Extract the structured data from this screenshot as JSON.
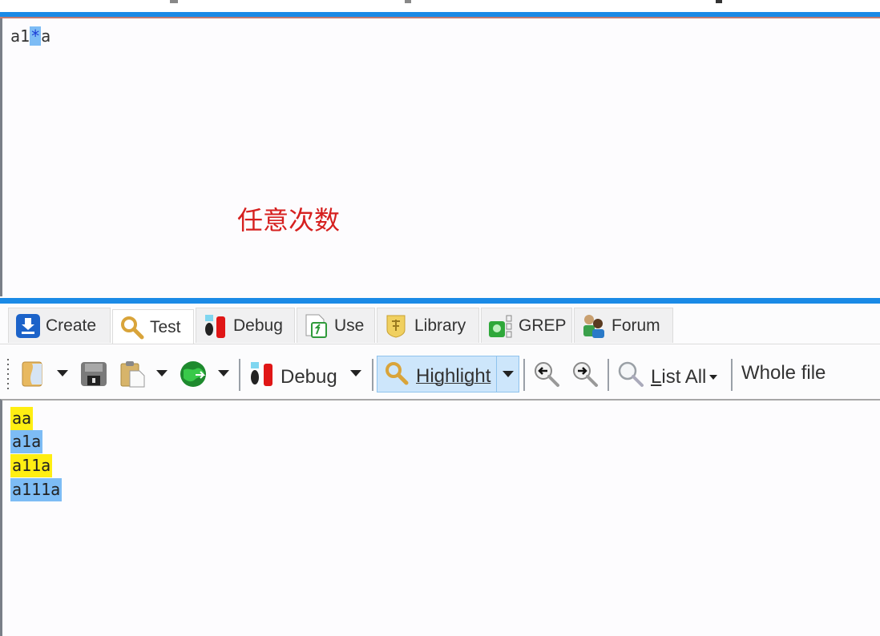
{
  "regex_editor": {
    "before": "a1",
    "highlighted": "*",
    "after": "a"
  },
  "annotation": {
    "text": "任意次数",
    "color": "#d6201f"
  },
  "tabs": [
    {
      "label": "Create",
      "icon": "create-icon",
      "active": false
    },
    {
      "label": "Test",
      "icon": "magnifier-icon",
      "active": true
    },
    {
      "label": "Debug",
      "icon": "debug-icon",
      "active": false
    },
    {
      "label": "Use",
      "icon": "use-icon",
      "active": false
    },
    {
      "label": "Library",
      "icon": "library-icon",
      "active": false
    },
    {
      "label": "GREP",
      "icon": "grep-icon",
      "active": false
    },
    {
      "label": "Forum",
      "icon": "forum-icon",
      "active": false
    }
  ],
  "toolbar": {
    "debug_label": "Debug",
    "highlight_label": "Highlight",
    "list_all_label": "List All",
    "scope_label": "Whole file"
  },
  "results": {
    "lines": [
      {
        "text": "aa",
        "highlight": "yellow"
      },
      {
        "text": "a1a",
        "highlight": "blue"
      },
      {
        "text": "a11a",
        "highlight": "yellow"
      },
      {
        "text": "a111a",
        "highlight": "blue"
      }
    ]
  },
  "colors": {
    "accent_blue": "#1a8ae6",
    "match_yellow": "#ffee12",
    "match_blue": "#7dbcf5"
  }
}
